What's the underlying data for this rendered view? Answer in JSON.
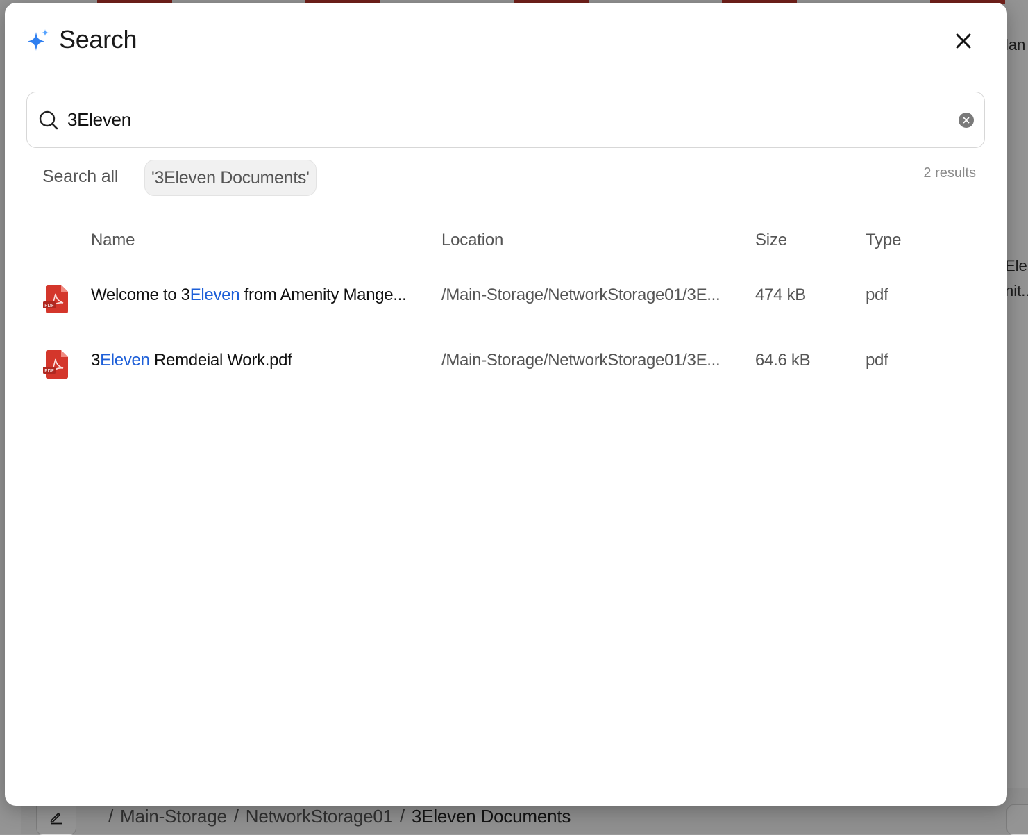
{
  "background": {
    "side_text_1": "lan",
    "side_text_2": "Ele",
    "side_text_3": "nit...",
    "breadcrumb": [
      "Main-Storage",
      "NetworkStorage01",
      "3Eleven Documents"
    ]
  },
  "modal": {
    "title": "Search",
    "sparkle_icon": "sparkle-icon",
    "close_icon": "close-icon"
  },
  "search": {
    "value": "3Eleven",
    "placeholder": "Search"
  },
  "scope": {
    "all_label": "Search all",
    "current_label": "'3Eleven Documents'",
    "result_count": "2 results"
  },
  "table": {
    "headers": {
      "name": "Name",
      "location": "Location",
      "size": "Size",
      "type": "Type"
    },
    "rows": [
      {
        "name_before": "Welcome to 3",
        "name_match": "Eleven",
        "name_after": " from Amenity Mange...",
        "location": "/Main-Storage/NetworkStorage01/3E...",
        "size": "474 kB",
        "type": "pdf",
        "icon": "pdf-file-icon"
      },
      {
        "name_before": "3",
        "name_match": "Eleven",
        "name_after": " Remdeial Work.pdf",
        "location": "/Main-Storage/NetworkStorage01/3E...",
        "size": "64.6 kB",
        "type": "pdf",
        "icon": "pdf-file-icon"
      }
    ]
  },
  "colors": {
    "highlight": "#1d5fd8",
    "pdf_red": "#d4362b",
    "sparkle_blue": "#2f7ff0"
  }
}
